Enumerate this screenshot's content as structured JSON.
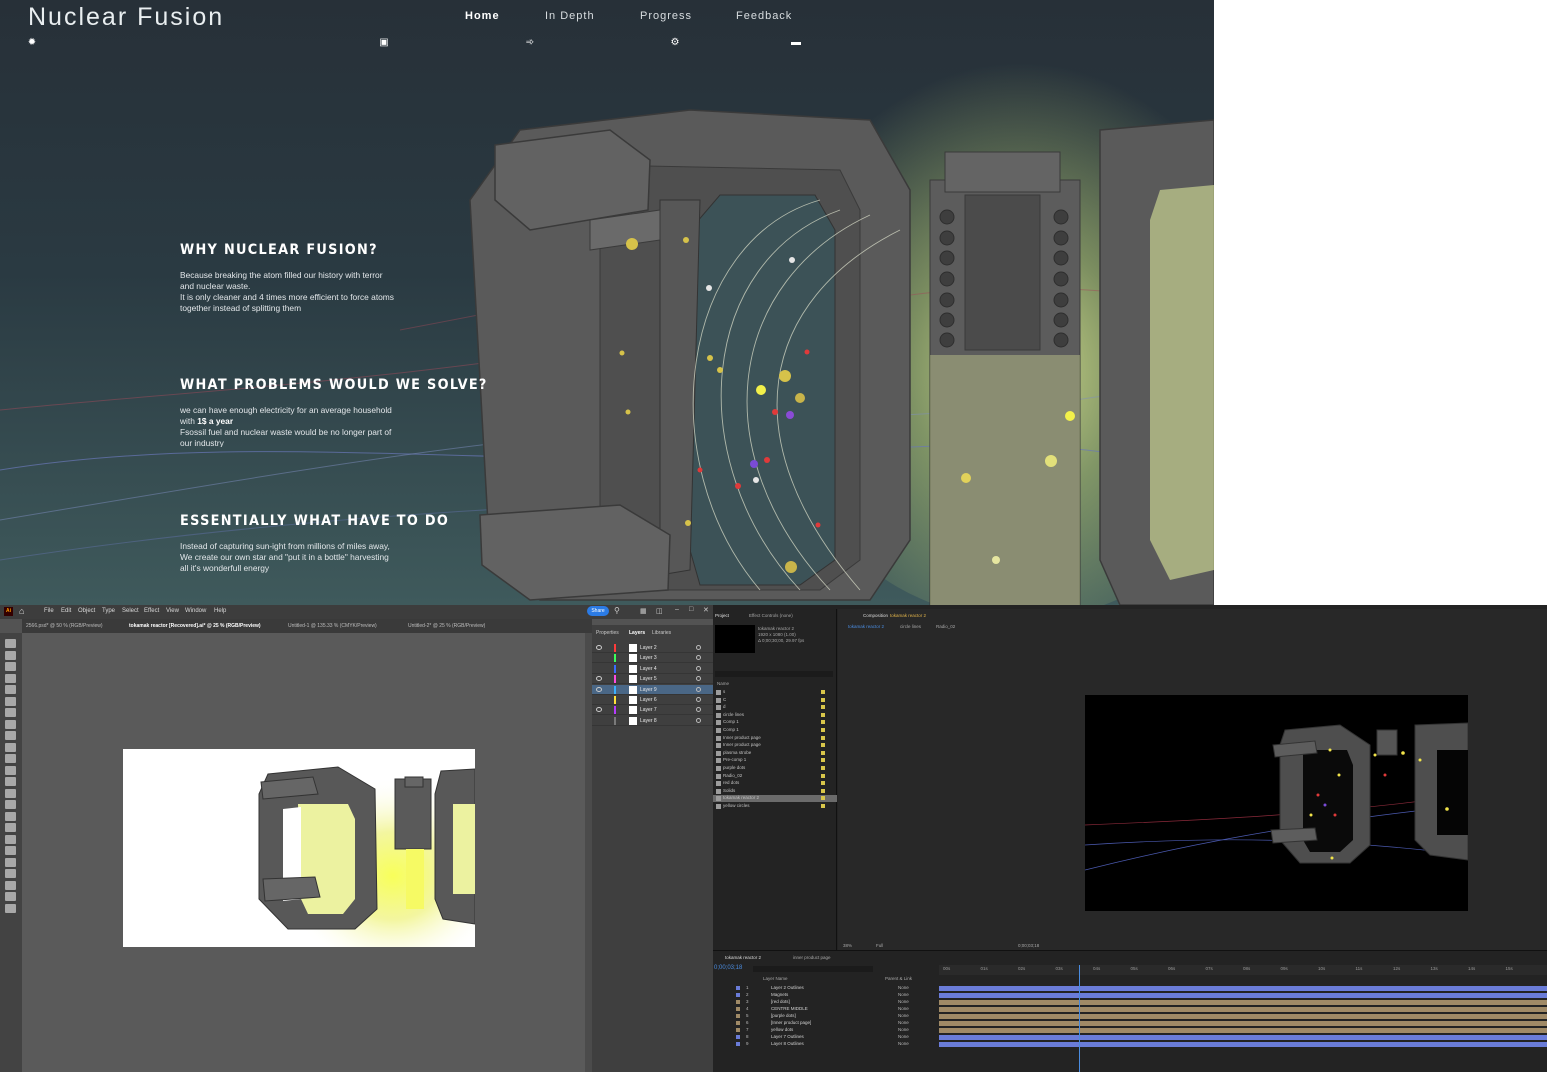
{
  "website": {
    "logo": "Nuclear Fusion",
    "nav": [
      {
        "label": "Home",
        "icon": "atom-icon",
        "active": true
      },
      {
        "label": "In Depth",
        "icon": "book-icon",
        "active": false
      },
      {
        "label": "Progress",
        "icon": "chart-icon",
        "active": false
      },
      {
        "label": "Feedback",
        "icon": "gears-icon",
        "active": false
      }
    ],
    "extra_icon": "toggle-icon",
    "sections": [
      {
        "title": "WHY NUCLEAR FUSION?",
        "lines": [
          "Because breaking the atom filled our history with terror",
          "and nuclear waste.",
          "It is only cleaner and 4 times more efficient to force atoms",
          "together instead of splitting them"
        ]
      },
      {
        "title": "WHAT PROBLEMS WOULD WE SOLVE?",
        "lines_a": [
          "we can have enough electricity for an average household"
        ],
        "line_b_prefix": "with ",
        "line_b_bold": "1$ a year",
        "lines_c": [
          "Fsossil fuel and nuclear waste would be no longer part of",
          "our industry"
        ]
      },
      {
        "title": "ESSENTIALLY WHAT HAVE TO DO",
        "lines": [
          "Instead of capturing sun-ight from millions of miles away,",
          "We create our own star and \"put it in a bottle\" harvesting",
          "all it's wonderfull energy"
        ]
      }
    ],
    "colors": {
      "background": "#273038",
      "glow": "#e9f39a",
      "frame": "#5c5c5c"
    }
  },
  "illustrator": {
    "app_badge": "Ai",
    "menus": [
      "File",
      "Edit",
      "Object",
      "Type",
      "Select",
      "Effect",
      "View",
      "Window",
      "Help"
    ],
    "share_label": "Share",
    "tabs": [
      {
        "label": "2566.psd* @ 50 % (RGB/Preview)",
        "active": false
      },
      {
        "label": "tokamak reactor [Recovered].ai* @ 25 % (RGB/Preview)",
        "active": true
      },
      {
        "label": "Untitled-1 @ 135.33 % (CMYK/Preview)",
        "active": false
      },
      {
        "label": "Untitled-2* @ 25 % (RGB/Preview)",
        "active": false
      }
    ],
    "panel_tabs": [
      "Properties",
      "Layers",
      "Libraries"
    ],
    "active_panel_tab": "Layers",
    "layers": [
      {
        "name": "Layer 2",
        "color": "#ff3b3b",
        "visible": true,
        "selected": false
      },
      {
        "name": "Layer 3",
        "color": "#3bff5b",
        "visible": false,
        "selected": false
      },
      {
        "name": "Layer 4",
        "color": "#3b6bff",
        "visible": false,
        "selected": false
      },
      {
        "name": "Layer 5",
        "color": "#ff4be0",
        "visible": true,
        "selected": false
      },
      {
        "name": "Layer 9",
        "color": "#3bb0ff",
        "visible": true,
        "selected": true
      },
      {
        "name": "Layer 6",
        "color": "#ffe23b",
        "visible": false,
        "selected": false
      },
      {
        "name": "Layer 7",
        "color": "#b63bff",
        "visible": true,
        "selected": false
      },
      {
        "name": "Layer 8",
        "color": "#7a7a7a",
        "visible": false,
        "selected": false
      }
    ]
  },
  "after_effects": {
    "panel_project": "Project",
    "panel_effect": "Effect Controls (none)",
    "comp_panel_label": "Composition",
    "comp_name": "tokamak reactor 2",
    "comp_tabs": [
      "tokamak reactor 2",
      "circle lines",
      "Radio_02"
    ],
    "comp_info": [
      "tokamak reactor 2",
      "1920 x 1080 (1.00)",
      "Δ 0;00;30;00, 29.97 fps"
    ],
    "name_header": "Name",
    "project_items": [
      {
        "name": "s",
        "selected": false
      },
      {
        "name": "C",
        "selected": false
      },
      {
        "name": "d",
        "selected": false
      },
      {
        "name": "circle lines",
        "selected": false
      },
      {
        "name": "Comp 1",
        "selected": false
      },
      {
        "name": "Comp 1",
        "selected": false
      },
      {
        "name": "Inner product page",
        "selected": false
      },
      {
        "name": "Inner product page",
        "selected": false
      },
      {
        "name": "plasma strobe",
        "selected": false
      },
      {
        "name": "Pre-comp 1",
        "selected": false
      },
      {
        "name": "purple dots",
        "selected": false
      },
      {
        "name": "Radio_02",
        "selected": false
      },
      {
        "name": "red dots",
        "selected": false
      },
      {
        "name": "Solids",
        "selected": false
      },
      {
        "name": "tokamak reactor 2",
        "selected": true
      },
      {
        "name": "yellow circles",
        "selected": false
      }
    ],
    "viewer_zoom": "38%",
    "viewer_quality": "Full",
    "viewer_timecode": "0;00;03;18",
    "timeline_tabs": [
      "tokamak reactor 2",
      "inner product page"
    ],
    "timecode": "0;00;03;18",
    "layer_header": "Layer Name",
    "mode_header": "Parent & Link",
    "layers": [
      {
        "num": "1",
        "name": "Layer 2 Outlines",
        "color": "#6a7cd8",
        "mode": "None"
      },
      {
        "num": "2",
        "name": "Magnets",
        "color": "#6a7cd8",
        "mode": "None"
      },
      {
        "num": "3",
        "name": "[red dots]",
        "color": "#a08a66",
        "mode": "None"
      },
      {
        "num": "4",
        "name": "CENTRE MIDDLE",
        "color": "#a08a66",
        "mode": "None"
      },
      {
        "num": "5",
        "name": "[purple dots]",
        "color": "#a08a66",
        "mode": "None"
      },
      {
        "num": "6",
        "name": "[Inner product page]",
        "color": "#a08a66",
        "mode": "None"
      },
      {
        "num": "7",
        "name": "yellow dots",
        "color": "#a08a66",
        "mode": "None"
      },
      {
        "num": "8",
        "name": "Layer 7 Outlines",
        "color": "#6a7cd8",
        "mode": "None"
      },
      {
        "num": "9",
        "name": "Layer 8 Outlines",
        "color": "#6a7cd8",
        "mode": "None"
      }
    ],
    "ruler_labels": [
      "00s",
      "01s",
      "02s",
      "03s",
      "04s",
      "05s",
      "06s",
      "07s",
      "08s",
      "09s",
      "10s",
      "11s",
      "12s",
      "13s",
      "14s",
      "15s"
    ],
    "playhead_fraction": 0.23
  }
}
